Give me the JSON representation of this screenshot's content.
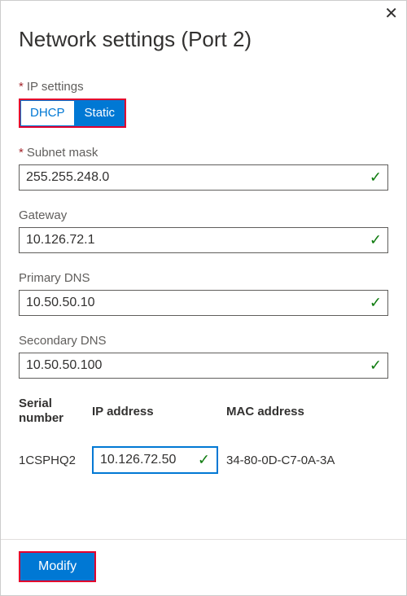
{
  "title": "Network settings (Port 2)",
  "required_mark": "*",
  "ip_settings": {
    "label": "IP settings",
    "options": {
      "dhcp": "DHCP",
      "static": "Static"
    },
    "selected": "static"
  },
  "fields": {
    "subnet": {
      "label": "Subnet mask",
      "value": "255.255.248.0",
      "required": true,
      "valid": true
    },
    "gateway": {
      "label": "Gateway",
      "value": "10.126.72.1",
      "required": false,
      "valid": true
    },
    "primary_dns": {
      "label": "Primary DNS",
      "value": "10.50.50.10",
      "required": false,
      "valid": true
    },
    "secondary_dns": {
      "label": "Secondary DNS",
      "value": "10.50.50.100",
      "required": false,
      "valid": true
    }
  },
  "table": {
    "headers": {
      "serial": "Serial number",
      "ip": "IP address",
      "mac": "MAC address"
    },
    "row": {
      "serial": "1CSPHQ2",
      "ip": "10.126.72.50",
      "ip_valid": true,
      "mac": "34-80-0D-C7-0A-3A"
    }
  },
  "check_glyph": "✓",
  "close_glyph": "✕",
  "modify_label": "Modify"
}
